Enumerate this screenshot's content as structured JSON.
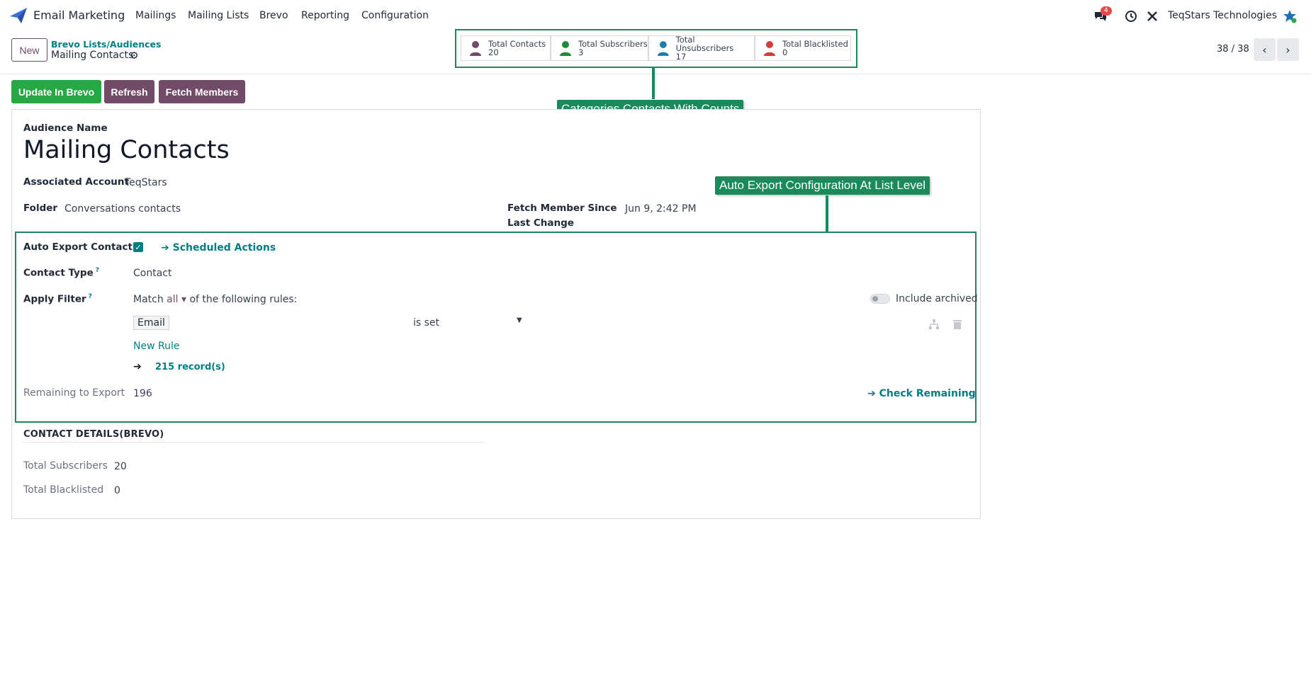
{
  "nav": {
    "app_name": "Email Marketing",
    "menus": [
      "Mailings",
      "Mailing Lists",
      "Brevo",
      "Reporting",
      "Configuration"
    ],
    "chat_badge": "4",
    "company": "TeqStars Technologies"
  },
  "control": {
    "new_label": "New",
    "breadcrumb": "Brevo Lists/Audiences",
    "record_title": "Mailing Contacts",
    "pager": "38 / 38"
  },
  "stats": [
    {
      "label": "Total Contacts",
      "count": "20",
      "color": "#714b67"
    },
    {
      "label": "Total Subscribers",
      "count": "3",
      "color": "#1e8b3a"
    },
    {
      "label": "Total Unsubscribers",
      "count": "17",
      "color": "#1a7fa8"
    },
    {
      "label": "Total Blacklisted",
      "count": "0",
      "color": "#d23b3b"
    }
  ],
  "callouts": {
    "categories": "Categories Contacts With Counts",
    "auto_export": "Auto Export Configuration At List Level"
  },
  "actions": {
    "update": "Update In Brevo",
    "refresh": "Refresh",
    "fetch": "Fetch Members"
  },
  "form": {
    "audience_name_label": "Audience Name",
    "audience_name": "Mailing Contacts",
    "associated_account_label": "Associated Account",
    "associated_account": "TeqStars",
    "folder_label": "Folder",
    "folder": "Conversations contacts",
    "fetch_since_label_1": "Fetch Member Since",
    "fetch_since_label_2": "Last Change",
    "fetch_since": "Jun 9, 2:42 PM",
    "auto_export_label": "Auto Export Contact?",
    "scheduled_actions": "Scheduled Actions",
    "contact_type_label": "Contact Type",
    "contact_type": "Contact",
    "apply_filter_label": "Apply Filter",
    "match_prefix": "Match",
    "match_value": "all",
    "match_suffix": "of the following rules:",
    "include_archived": "Include archived",
    "rule_field": "Email",
    "rule_operator": "is set",
    "new_rule": "New Rule",
    "records": "215 record(s)",
    "remaining_label": "Remaining to Export",
    "remaining": "196",
    "check_remaining": "Check Remaining",
    "section_title": "CONTACT DETAILS(BREVO)",
    "total_subscribers_label": "Total Subscribers",
    "total_subscribers": "20",
    "total_blacklisted_label": "Total Blacklisted",
    "total_blacklisted": "0"
  },
  "colors": {
    "brand": "#714b67",
    "teal": "#017e84",
    "annotation": "#1a8a5d",
    "success": "#28a745"
  }
}
